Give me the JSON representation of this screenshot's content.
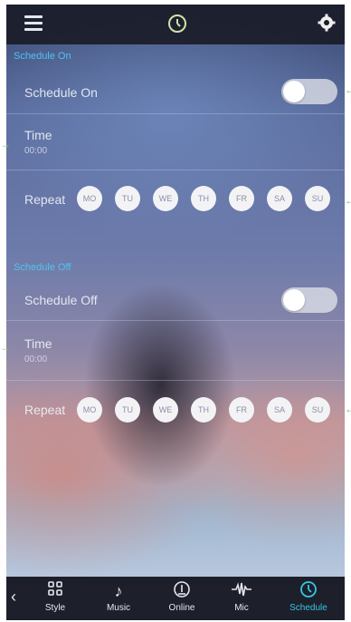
{
  "colors": {
    "accent": "#37c6e4",
    "section_title": "#4fc3f0",
    "bar_bg": "#1a1c28"
  },
  "topbar": {
    "left_icon": "menu-icon",
    "center_icon": "clock-icon",
    "right_icon": "gear-icon"
  },
  "schedule_on": {
    "section_title": "Schedule On",
    "toggle_label": "Schedule On",
    "toggle_state": "off",
    "time_label": "Time",
    "time_value": "00:00",
    "repeat_label": "Repeat",
    "days": [
      "MO",
      "TU",
      "WE",
      "TH",
      "FR",
      "SA",
      "SU"
    ]
  },
  "schedule_off": {
    "section_title": "Schedule Off",
    "toggle_label": "Schedule Off",
    "toggle_state": "off",
    "time_label": "Time",
    "time_value": "00:00",
    "repeat_label": "Repeat",
    "days": [
      "MO",
      "TU",
      "WE",
      "TH",
      "FR",
      "SA",
      "SU"
    ]
  },
  "bottom_nav": {
    "back_icon": "chevron-left-icon",
    "items": [
      {
        "label": "Style",
        "icon": "grid-icon",
        "active": false
      },
      {
        "label": "Music",
        "icon": "music-note-icon",
        "active": false
      },
      {
        "label": "Online",
        "icon": "online-icon",
        "active": false
      },
      {
        "label": "Mic",
        "icon": "mic-icon",
        "active": false
      },
      {
        "label": "Schedule",
        "icon": "clock-icon",
        "active": true
      }
    ]
  }
}
